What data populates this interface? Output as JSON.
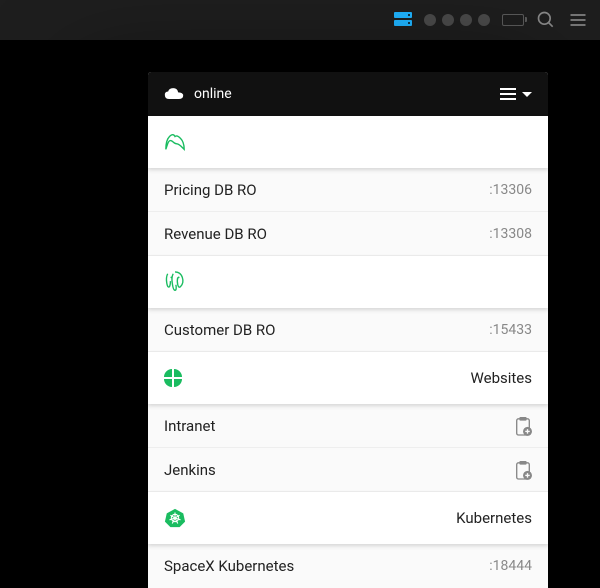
{
  "topbar": {
    "icons": [
      "server",
      "dots",
      "battery",
      "search",
      "menu"
    ]
  },
  "panel": {
    "status": "online",
    "sections": [
      {
        "icon": "mysql",
        "label": "",
        "items": [
          {
            "name": "Pricing DB RO",
            "port": ":13306"
          },
          {
            "name": "Revenue DB RO",
            "port": ":13308"
          }
        ]
      },
      {
        "icon": "postgres",
        "label": "",
        "items": [
          {
            "name": "Customer DB RO",
            "port": ":15433"
          }
        ]
      },
      {
        "icon": "globe",
        "label": "Websites",
        "items": [
          {
            "name": "Intranet",
            "action": "clipboard"
          },
          {
            "name": "Jenkins",
            "action": "clipboard"
          }
        ]
      },
      {
        "icon": "k8s",
        "label": "Kubernetes",
        "items": [
          {
            "name": "SpaceX Kubernetes",
            "port": ":18444"
          }
        ]
      }
    ]
  }
}
